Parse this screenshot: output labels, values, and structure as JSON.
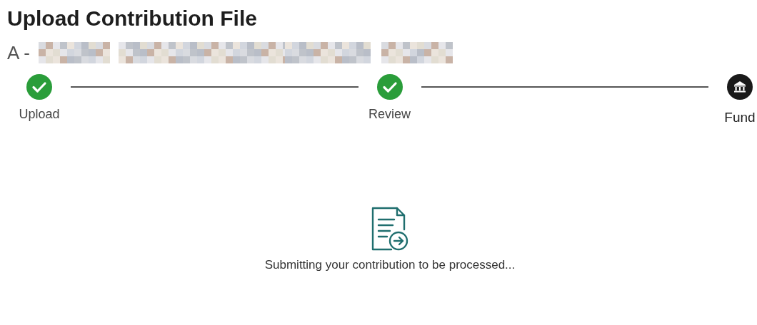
{
  "page": {
    "title": "Upload Contribution File",
    "subtitle_prefix": "A -"
  },
  "steps": [
    {
      "label": "Upload",
      "completed": true,
      "kind": "check"
    },
    {
      "label": "Review",
      "completed": true,
      "kind": "check"
    },
    {
      "label": "Fund",
      "completed": false,
      "kind": "bank"
    }
  ],
  "status": {
    "message": "Submitting your contribution to be processed..."
  }
}
